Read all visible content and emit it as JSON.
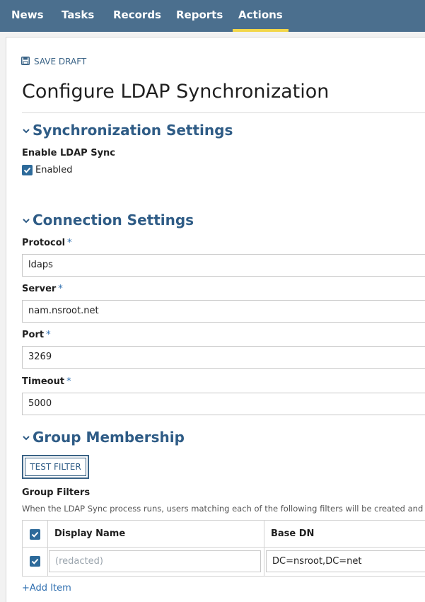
{
  "nav": {
    "items": [
      "News",
      "Tasks",
      "Records",
      "Reports",
      "Actions"
    ],
    "active": "Actions"
  },
  "toolbar": {
    "save_draft_label": "SAVE DRAFT"
  },
  "page": {
    "title": "Configure LDAP Synchronization"
  },
  "sync_settings": {
    "heading": "Synchronization Settings",
    "enable_label": "Enable LDAP Sync",
    "enabled_checkbox_label": "Enabled",
    "enabled_checked": true
  },
  "connection": {
    "heading": "Connection Settings",
    "required_marker": "*",
    "protocol_label": "Protocol",
    "protocol_value": "ldaps",
    "server_label": "Server",
    "server_value": "nam.nsroot.net",
    "port_label": "Port",
    "port_value": "3269",
    "timeout_label": "Timeout",
    "timeout_value": "5000"
  },
  "group_membership": {
    "heading": "Group Membership",
    "test_filter_label": "TEST FILTER",
    "group_filters_label": "Group Filters",
    "help_text": "When the LDAP Sync process runs, users matching each of the following filters will be created and ad",
    "table": {
      "columns": [
        "Display Name",
        "Base DN"
      ],
      "rows": [
        {
          "checked": true,
          "display_name": "(redacted)",
          "base_dn": "DC=nsroot,DC=net"
        }
      ]
    },
    "add_item_label": "+Add Item"
  },
  "colors": {
    "nav_bg": "#4b6f8e",
    "nav_active_underline": "#f2d649",
    "accent": "#2f5c86",
    "checkbox": "#2d6a9a"
  },
  "icons": {
    "save": "floppy-disk-icon",
    "section_toggle": "chevron-down-icon",
    "check": "checkmark-icon"
  }
}
